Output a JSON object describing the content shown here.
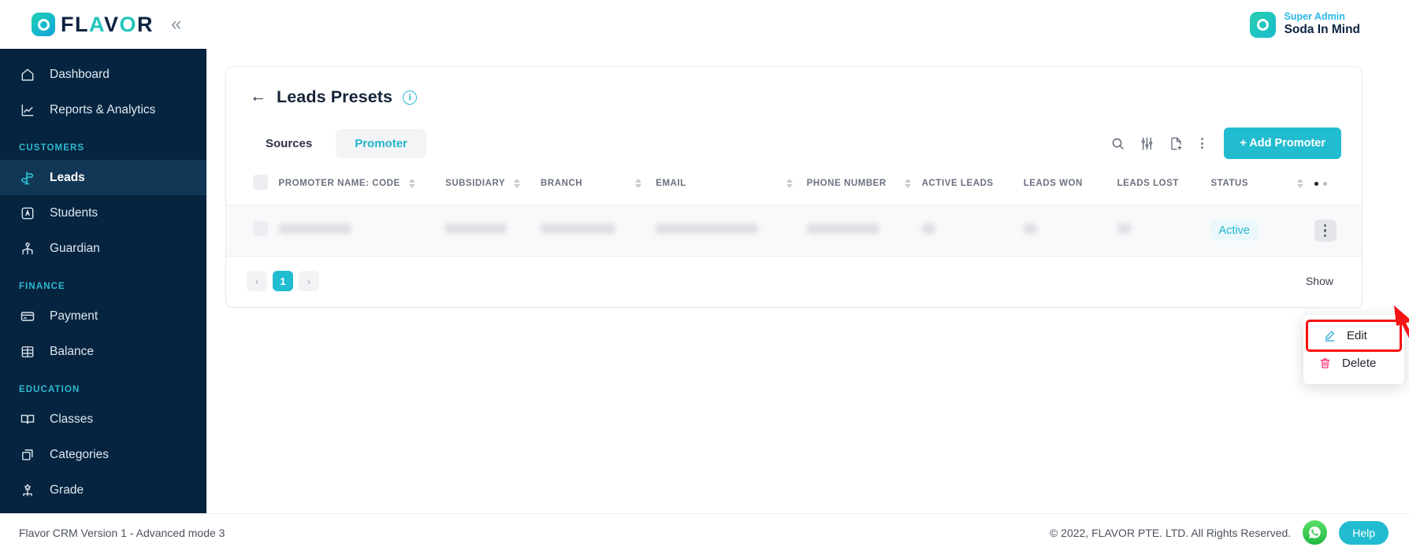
{
  "brand": {
    "logo_text_dark_1": "F",
    "logo_text": "FLAVOR",
    "collapse_icon": "chevron-double-left"
  },
  "user": {
    "role": "Super Admin",
    "name": "Soda In Mind"
  },
  "sidebar": {
    "items": [
      {
        "label": "Dashboard",
        "icon": "home-icon",
        "active": false
      },
      {
        "label": "Reports & Analytics",
        "icon": "chart-line-icon",
        "active": false
      }
    ],
    "groups": [
      {
        "title": "CUSTOMERS",
        "items": [
          {
            "label": "Leads",
            "icon": "signpost-icon",
            "active": true
          },
          {
            "label": "Students",
            "icon": "student-badge-icon",
            "active": false
          },
          {
            "label": "Guardian",
            "icon": "guardian-icon",
            "active": false
          }
        ]
      },
      {
        "title": "FINANCE",
        "items": [
          {
            "label": "Payment",
            "icon": "credit-card-icon",
            "active": false
          },
          {
            "label": "Balance",
            "icon": "balance-stack-icon",
            "active": false
          }
        ]
      },
      {
        "title": "EDUCATION",
        "items": [
          {
            "label": "Classes",
            "icon": "open-book-icon",
            "active": false
          },
          {
            "label": "Categories",
            "icon": "boxes-icon",
            "active": false
          },
          {
            "label": "Grade",
            "icon": "hierarchy-icon",
            "active": false
          }
        ]
      }
    ]
  },
  "page": {
    "title": "Leads Presets",
    "back_icon": "arrow-left-icon",
    "info_icon": "info-circle-icon",
    "info_char": "i"
  },
  "tabs": [
    {
      "label": "Sources",
      "active": false
    },
    {
      "label": "Promoter",
      "active": true
    }
  ],
  "toolbar": {
    "icons": [
      {
        "name": "search-icon"
      },
      {
        "name": "filter-sliders-icon"
      },
      {
        "name": "export-document-icon"
      },
      {
        "name": "more-vertical-icon"
      }
    ],
    "add_button": "+ Add Promoter"
  },
  "table": {
    "columns": [
      {
        "label": "PROMOTER NAME: CODE",
        "sortable": true
      },
      {
        "label": "SUBSIDIARY",
        "sortable": true
      },
      {
        "label": "BRANCH",
        "sortable": true
      },
      {
        "label": "EMAIL",
        "sortable": true
      },
      {
        "label": "PHONE NUMBER",
        "sortable": true
      },
      {
        "label": "ACTIVE LEADS",
        "sortable": false
      },
      {
        "label": "LEADS WON",
        "sortable": false
      },
      {
        "label": "LEADS LOST",
        "sortable": false
      },
      {
        "label": "STATUS",
        "sortable": true
      }
    ],
    "rows": [
      {
        "promoter_name_code": "",
        "subsidiary": "",
        "branch": "",
        "email": "",
        "phone_number": "",
        "active_leads": "",
        "leads_won": "",
        "leads_lost": "",
        "status": "Active",
        "redacted": true
      }
    ]
  },
  "pagination": {
    "prev": "‹",
    "pages": [
      "1"
    ],
    "current": "1",
    "next": "›",
    "show_label": "Show"
  },
  "context_menu": {
    "items": [
      {
        "label": "Edit",
        "icon": "pencil-edit-icon",
        "highlighted": true
      },
      {
        "label": "Delete",
        "icon": "trash-delete-icon",
        "highlighted": false
      }
    ]
  },
  "footer": {
    "version": "Flavor CRM Version 1 - Advanced mode 3",
    "copyright": "© 2022, FLAVOR PTE. LTD. All Rights Reserved.",
    "whatsapp_icon": "whatsapp-icon",
    "help_label": "Help"
  },
  "colors": {
    "accent": "#22bcd0",
    "sidebar_bg": "#062440",
    "sidebar_active": "#123756",
    "group_label": "#2eb8cf",
    "title_dark": "#16243a",
    "annotation_red": "#fa0f0f",
    "whatsapp_green": "#25d366"
  }
}
